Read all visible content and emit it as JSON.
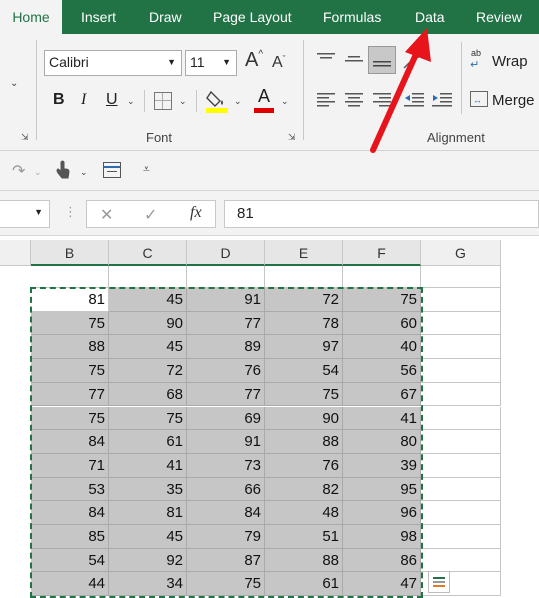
{
  "tabs": [
    {
      "label": "Home",
      "active": true
    },
    {
      "label": "Insert",
      "active": false
    },
    {
      "label": "Draw",
      "active": false
    },
    {
      "label": "Page Layout",
      "active": false
    },
    {
      "label": "Formulas",
      "active": false
    },
    {
      "label": "Data",
      "active": false
    },
    {
      "label": "Review",
      "active": false
    }
  ],
  "ribbon": {
    "font_name": "Calibri",
    "font_size": "11",
    "bold": "B",
    "italic": "I",
    "underline": "U",
    "grow_font": "A",
    "shrink_font": "A",
    "font_color": "A",
    "wrap_label": "Wrap",
    "merge_label": "Merge",
    "font_group_label": "Font",
    "alignment_group_label": "Alignment",
    "orientation_icon_text": "ab"
  },
  "formula_bar": {
    "fx": "fx",
    "value": "81"
  },
  "columns": [
    "B",
    "C",
    "D",
    "E",
    "F",
    "G"
  ],
  "rows": [
    [
      "81",
      "45",
      "91",
      "72",
      "75"
    ],
    [
      "75",
      "90",
      "77",
      "78",
      "60"
    ],
    [
      "88",
      "45",
      "89",
      "97",
      "40"
    ],
    [
      "75",
      "72",
      "76",
      "54",
      "56"
    ],
    [
      "77",
      "68",
      "77",
      "75",
      "67"
    ],
    [
      "75",
      "75",
      "69",
      "90",
      "41"
    ],
    [
      "84",
      "61",
      "91",
      "88",
      "80"
    ],
    [
      "71",
      "41",
      "73",
      "76",
      "39"
    ],
    [
      "53",
      "35",
      "66",
      "82",
      "95"
    ],
    [
      "84",
      "81",
      "84",
      "48",
      "96"
    ],
    [
      "85",
      "45",
      "79",
      "51",
      "98"
    ],
    [
      "54",
      "92",
      "87",
      "88",
      "86"
    ],
    [
      "44",
      "34",
      "75",
      "61",
      "47"
    ]
  ],
  "colors": {
    "excel_green": "#217346",
    "selection_fill": "#c6c6c6",
    "annotation_arrow": "#e8141b",
    "font_color_underline": "#e00000",
    "highlight_yellow": "#ffff00"
  }
}
